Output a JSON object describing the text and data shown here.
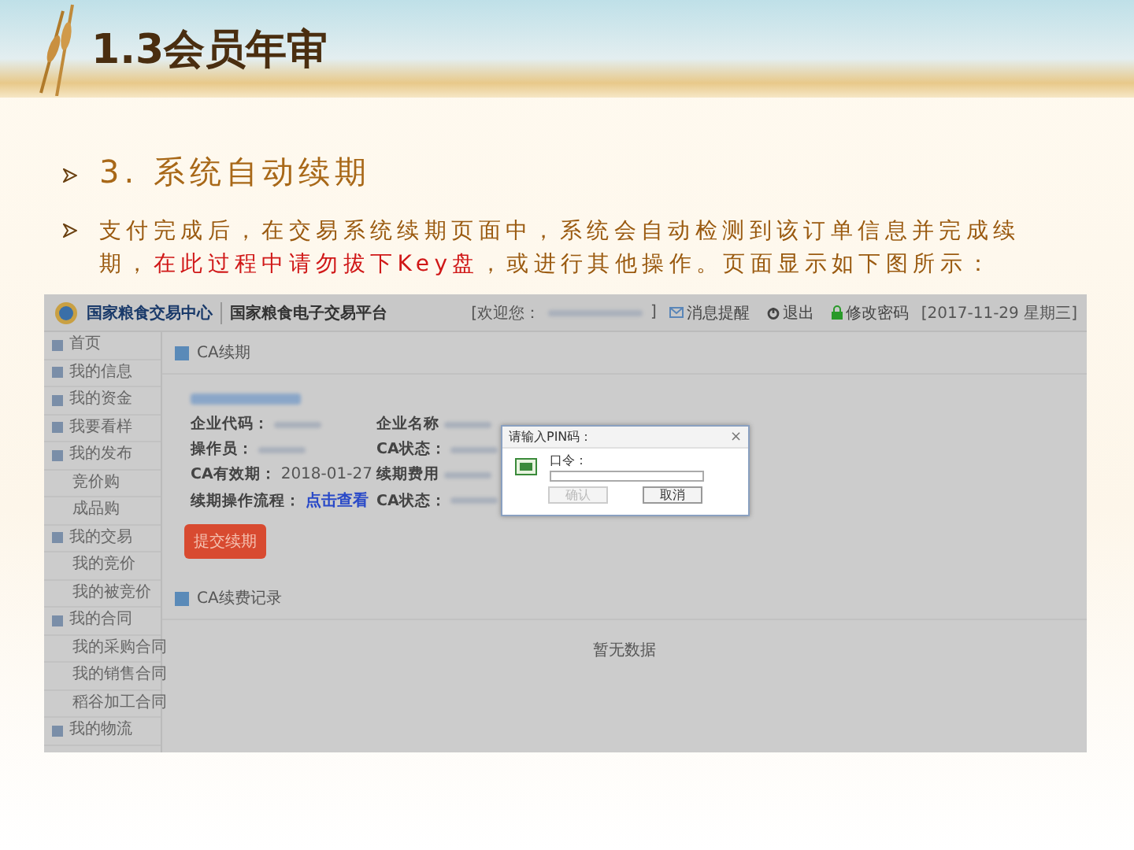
{
  "slide": {
    "title": "1.3会员年审"
  },
  "bullets": [
    {
      "kind": "heading",
      "segments": [
        {
          "text": "3. 系统自动续期",
          "emphasis": false
        }
      ]
    },
    {
      "kind": "body",
      "segments": [
        {
          "text": "支付完成后，在交易系统续期页面中，系统会自动检测到该订单信息并完成续期，",
          "emphasis": false
        },
        {
          "text": "在此过程中请勿拔下Key盘",
          "emphasis": true
        },
        {
          "text": "，或进行其他操作。页面显示如下图所示：",
          "emphasis": false
        }
      ]
    }
  ],
  "screenshot": {
    "header": {
      "logo_text": "国家粮食交易中心",
      "platform": "国家粮食电子交易平台",
      "welcome_open": "[欢迎您：",
      "welcome_close": "]",
      "links": [
        {
          "kind": "mail",
          "label": "消息提醒"
        },
        {
          "kind": "power",
          "label": "退出"
        },
        {
          "kind": "lock",
          "label": "修改密码"
        }
      ],
      "date": "[2017-11-29 星期三]"
    },
    "sidebar": [
      {
        "label": "首页"
      },
      {
        "label": "我的信息"
      },
      {
        "label": "我的资金"
      },
      {
        "label": "我要看样"
      },
      {
        "label": "我的发布",
        "children": [
          {
            "label": "竞价购"
          },
          {
            "label": "成品购"
          }
        ]
      },
      {
        "label": "我的交易",
        "children": [
          {
            "label": "我的竞价"
          },
          {
            "label": "我的被竞价"
          }
        ]
      },
      {
        "label": "我的合同",
        "children": [
          {
            "label": "我的采购合同"
          },
          {
            "label": "我的销售合同"
          },
          {
            "label": "稻谷加工合同"
          }
        ]
      },
      {
        "label": "我的物流"
      }
    ],
    "panel": {
      "title": "CA续期",
      "fields": [
        {
          "label": "企业代码：",
          "kind": "blurred"
        },
        {
          "label": "企业名称",
          "kind": "blurred"
        },
        {
          "label": "操作员：",
          "kind": "blurred"
        },
        {
          "label": "CA状态：",
          "kind": "blurred"
        },
        {
          "label": "CA有效期：",
          "kind": "text",
          "value": "2018-01-27"
        },
        {
          "label": "续期费用",
          "kind": "blurred"
        },
        {
          "label": "续期操作流程：",
          "kind": "link",
          "value": "点击查看"
        },
        {
          "label": "CA状态：",
          "kind": "blurred"
        }
      ],
      "button": "提交续期"
    },
    "records": {
      "title": "CA续费记录",
      "empty": "暂无数据"
    },
    "dialog": {
      "title": "请输入PIN码：",
      "close": "×",
      "field_label": "口令：",
      "buttons": [
        {
          "label": "确认",
          "disabled": true
        },
        {
          "label": "取消",
          "disabled": false
        }
      ]
    }
  }
}
